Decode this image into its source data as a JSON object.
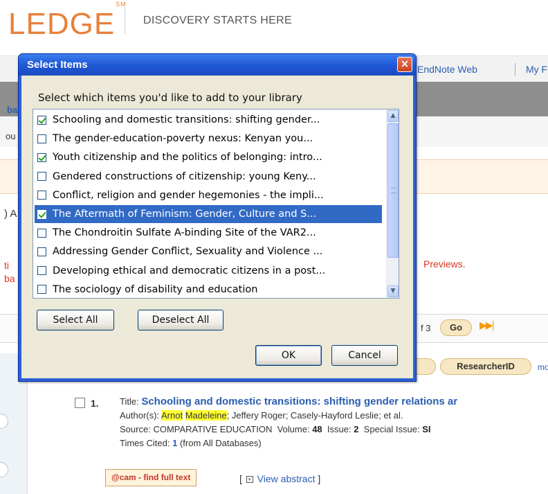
{
  "header": {
    "logo_text": "LEDGE",
    "logo_mark": "SM",
    "tagline": "DISCOVERY STARTS HERE"
  },
  "top_links": {
    "endnote": "EndNote Web",
    "my": "My F"
  },
  "page_fragments": {
    "f1": "ba",
    "f2": "ou",
    "f3": ") A",
    "f4": "ti",
    "f5": "ba",
    "previews": "Previews."
  },
  "results_nav": {
    "page_of": "f 3",
    "go_label": "Go"
  },
  "record_tools": {
    "researcherid": "ResearcherID",
    "more": "mo"
  },
  "record": {
    "number": "1.",
    "title_label": "Title:",
    "title": "Schooling and domestic transitions: shifting gender relations ar",
    "authors_label": "Author(s):",
    "author_hl_1": "Arnot",
    "author_hl_2": "Madeleine",
    "authors_rest": "; Jeffery Roger; Casely-Hayford Leslie; et al.",
    "source_label": "Source:",
    "source_journal": "COMPARATIVE EDUCATION",
    "volume_label": "Volume:",
    "volume": "48",
    "issue_label": "Issue:",
    "issue": "2",
    "special_label": "Special Issue:",
    "special": "SI",
    "cited_label": "Times Cited:",
    "cited_count": "1",
    "cited_suffix": "(from All Databases)",
    "fulltext_button": "@cam - find full text",
    "abstract_open": "[",
    "abstract_link": "View abstract",
    "abstract_close": "]"
  },
  "dialog": {
    "title": "Select Items",
    "close_icon": "×",
    "prompt": "Select which items you'd like to add to your library",
    "items": [
      {
        "label": "Schooling and domestic transitions: shifting gender...",
        "checked": true,
        "selected": false
      },
      {
        "label": "The gender-education-poverty nexus: Kenyan you...",
        "checked": false,
        "selected": false
      },
      {
        "label": "Youth citizenship and the politics of belonging: intro...",
        "checked": true,
        "selected": false
      },
      {
        "label": "Gendered constructions of citizenship: young Keny...",
        "checked": false,
        "selected": false
      },
      {
        "label": "Conflict, religion and gender hegemonies - the impli...",
        "checked": false,
        "selected": false
      },
      {
        "label": "The Aftermath of Feminism: Gender, Culture and S...",
        "checked": true,
        "selected": true
      },
      {
        "label": "The Chondroitin Sulfate A-binding Site of the VAR2...",
        "checked": false,
        "selected": false
      },
      {
        "label": "Addressing Gender Conflict, Sexuality and Violence ...",
        "checked": false,
        "selected": false
      },
      {
        "label": "Developing ethical and democratic citizens in a post...",
        "checked": false,
        "selected": false
      },
      {
        "label": "The sociology of disability and education",
        "checked": false,
        "selected": false
      }
    ],
    "select_all": "Select All",
    "deselect_all": "Deselect All",
    "ok": "OK",
    "cancel": "Cancel"
  },
  "colors": {
    "brand_orange": "#e8803a",
    "dialog_blue": "#2a60d6",
    "selection_blue": "#316ac5",
    "link_blue": "#2a5db0"
  }
}
